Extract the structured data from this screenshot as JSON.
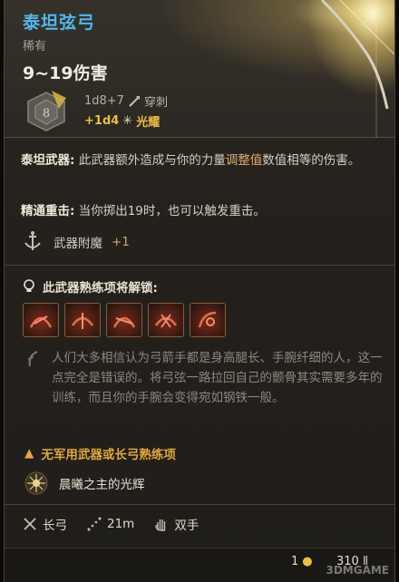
{
  "item": {
    "name": "泰坦弦弓",
    "rarity": "稀有",
    "damage_range": "9~19伤害",
    "dice_value": "8",
    "damage_base": "1d8+7",
    "damage_base_type": "穿刺",
    "damage_bonus": "+1d4",
    "damage_bonus_type": "光耀"
  },
  "passives": {
    "titan_label": "泰坦武器:",
    "titan_text_a": " 此武器额外造成与你的力量",
    "titan_highlight": "调整值",
    "titan_text_b": "数值相等的伤害。",
    "crit_label": "精通重击:",
    "crit_text": " 当你掷出19时，也可以触发重击。"
  },
  "enchant": {
    "label": "武器附魔",
    "value": "+1"
  },
  "proficiency": {
    "title": "此武器熟练项将解锁:",
    "actions": [
      "action-icon-1",
      "action-icon-2",
      "action-icon-3",
      "action-icon-4",
      "action-icon-5"
    ]
  },
  "lore": "人们大多相信认为弓箭手都是身高腿长、手腕纤细的人，这一点完全是错误的。将弓弦一路拉回自己的颤骨其实需要多年的训练，而且你的手腕会变得宛如钢铁一般。",
  "warning": "无军用武器或长弓熟练项",
  "special": "晨曦之主的光辉",
  "footer": {
    "type": "长弓",
    "range": "21m",
    "handedness": "双手"
  },
  "bottom": {
    "price": "1",
    "weight": "310"
  },
  "watermark": "3DMGAME",
  "colors": {
    "title": "#4fb8ee",
    "gold": "#e8c040",
    "warning": "#e0a838"
  }
}
